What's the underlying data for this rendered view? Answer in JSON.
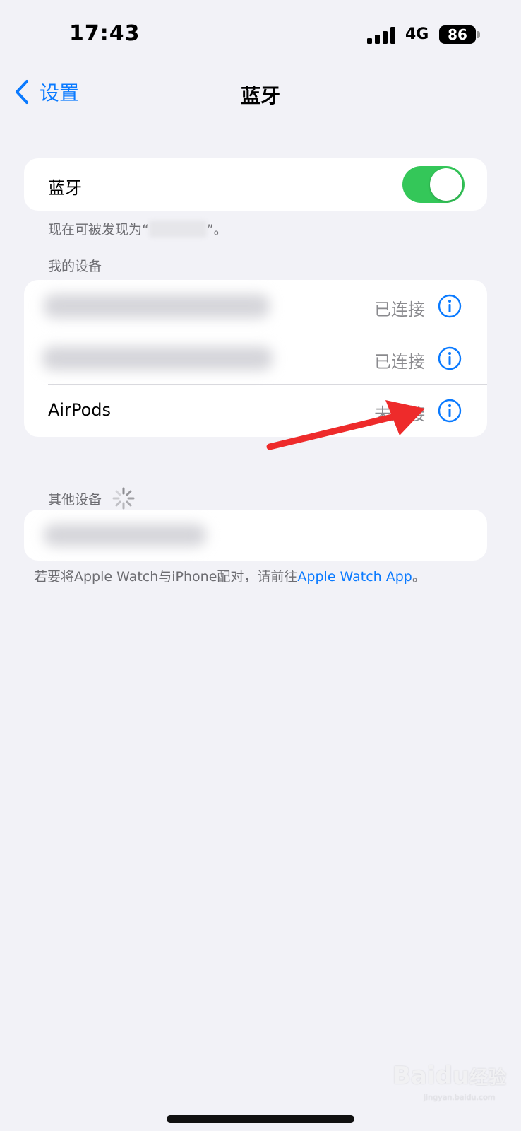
{
  "status_bar": {
    "time": "17:43",
    "network": "4G",
    "battery": "86"
  },
  "nav": {
    "back_label": "设置",
    "title": "蓝牙"
  },
  "bluetooth": {
    "toggle_label": "蓝牙",
    "enabled": true,
    "discoverable_prefix": "现在可被发现为“",
    "discoverable_suffix": "”。"
  },
  "my_devices": {
    "header": "我的设备",
    "items": [
      {
        "name": "",
        "status": "已连接"
      },
      {
        "name": "",
        "status": "已连接"
      },
      {
        "name": "AirPods",
        "status": "未连接"
      }
    ]
  },
  "other_devices": {
    "header": "其他设备"
  },
  "footer": {
    "text": "若要将Apple Watch与iPhone配对，请前往",
    "link": "Apple Watch App",
    "suffix": "。"
  },
  "watermark": {
    "text": "Bai",
    "text2": "du",
    "text3": "经验",
    "sub": "jingyan.baidu.com"
  },
  "colors": {
    "accent": "#0a7aff",
    "toggle_on": "#34c759",
    "arrow": "#ee2b2b"
  }
}
